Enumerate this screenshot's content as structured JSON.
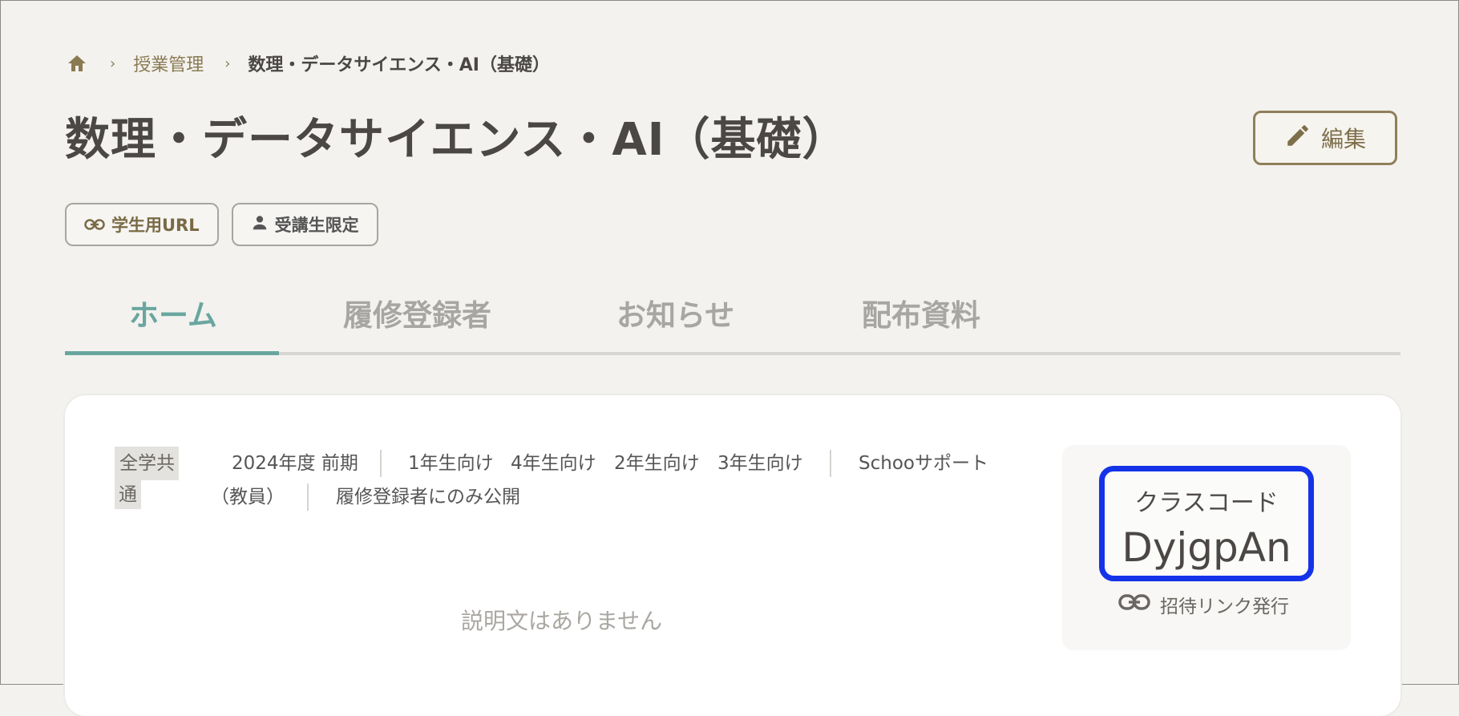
{
  "breadcrumb": {
    "icon": "home-icon",
    "items": [
      {
        "label": "授業管理"
      },
      {
        "label": "数理・データサイエンス・AI（基礎）"
      }
    ]
  },
  "page": {
    "title": "数理・データサイエンス・AI（基礎）",
    "edit_label": "編集"
  },
  "chips": {
    "student_url": "学生用URL",
    "attendee_only": "受講生限定"
  },
  "tabs": [
    {
      "label": "ホーム",
      "active": true
    },
    {
      "label": "履修登録者",
      "active": false
    },
    {
      "label": "お知らせ",
      "active": false
    },
    {
      "label": "配布資料",
      "active": false
    }
  ],
  "course": {
    "category_line1": "全学共",
    "category_line2": "通",
    "term": "2024年度 前期",
    "grades": [
      "1年生向け",
      "4年生向け",
      "2年生向け",
      "3年生向け"
    ],
    "owner_line1": "Schooサポート",
    "owner_line2": "（教員）",
    "visibility": "履修登録者にのみ公開",
    "description_empty": "説明文はありません"
  },
  "class_code": {
    "label": "クラスコード",
    "value": "DyjgpAn",
    "invite_label": "招待リンク発行"
  },
  "colors": {
    "accent_teal": "#6aa6a0",
    "brand_gold": "#8f7f5a",
    "highlight_blue": "#1433e8"
  }
}
